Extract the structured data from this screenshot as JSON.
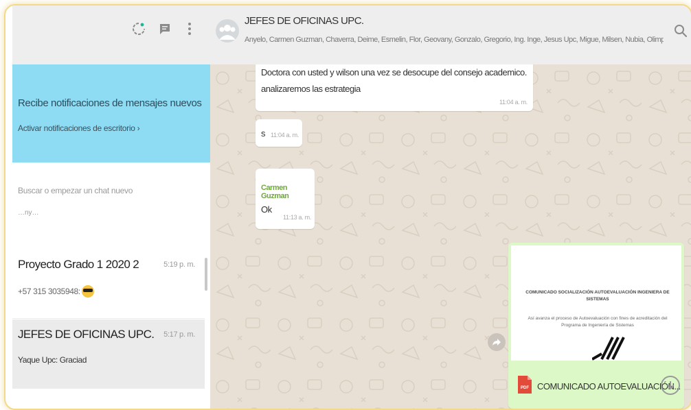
{
  "sidebar": {
    "notification": {
      "title": "Recibe notificaciones de mensajes nuevos",
      "action": "Activar notificaciones de escritorio ›"
    },
    "search": {
      "placeholder": "Buscar o empezar un chat nuevo"
    },
    "cut_snippet": "…ny…",
    "chats": [
      {
        "name": "Proyecto Grado 1 2020 2",
        "time": "5:19 p. m.",
        "last": "+57 315 3035948: "
      },
      {
        "name": "JEFES DE OFICINAS UPC.",
        "time": "5:17 p. m.",
        "last": "Yaque Upc: Graciad"
      }
    ]
  },
  "conversation": {
    "title": "JEFES DE OFICINAS UPC.",
    "members": "Anyelo, Carmen Guzman, Chaverra, Deime, Esmelin, Flor, Geovany, Gonzalo, Gregorio, Ing. Inge, Jesus Upc, Migue, Milsen, Nubia, Olimpo, ...",
    "messages": [
      {
        "line1": "Doctora con usted y wilson una vez se desocupe del consejo academico.",
        "line2": "analizaremos las estrategia",
        "time": "11:04 a. m."
      },
      {
        "text": "s",
        "time": "11:04 a. m."
      },
      {
        "sender": "Carmen Guzman",
        "text": "Ok",
        "time": "11:13 a. m."
      }
    ],
    "document": {
      "preview_heading": "COMUNICADO SOCIALIZACIÓN AUTOEVALUACIÓN INGENIERA DE SISTEMAS",
      "preview_text": "Así avanza el proceso de Autoevaluación con fines de acreditación del Programa de Ingeniería de Sistemas",
      "file_name": "COMUNICADO AUTOEVALUACIÓN..."
    }
  },
  "colors": {
    "notification_bg": "#8edcf4",
    "chat_bg": "#e8e0d4",
    "sender": "#6fa83a",
    "doc_card": "#dcf8c6",
    "pdf": "#e44a3a"
  }
}
